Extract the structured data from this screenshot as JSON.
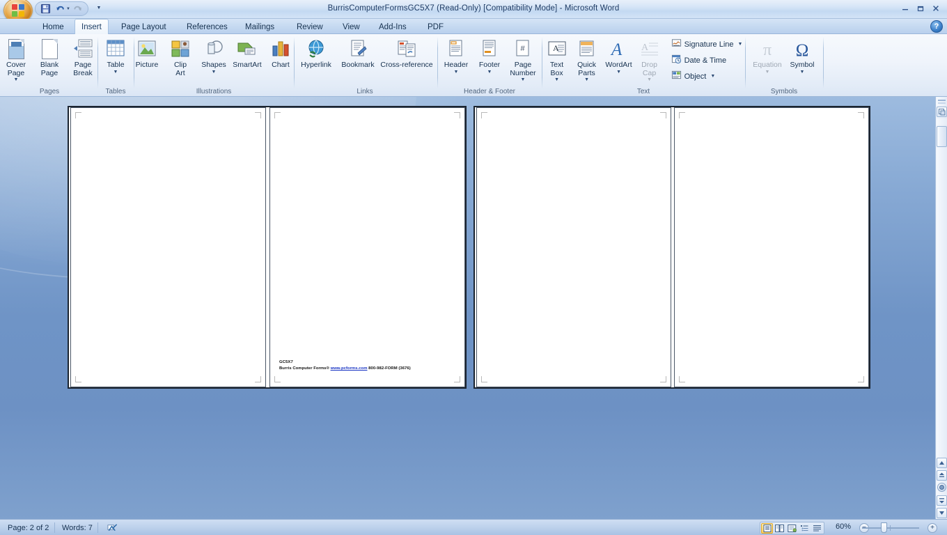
{
  "window": {
    "title": "BurrisComputerFormsGC5X7 (Read-Only) [Compatibility Mode] - Microsoft Word",
    "minimize_label": "Minimize",
    "restore_label": "Restore Down",
    "close_label": "Close",
    "help_label": "?"
  },
  "office_button": {
    "label": "Office Button"
  },
  "quick_access": {
    "items": [
      {
        "name": "save",
        "label": "Save",
        "icon": "save-icon"
      },
      {
        "name": "undo",
        "label": "Undo",
        "icon": "undo-icon",
        "dropdown": true
      },
      {
        "name": "redo",
        "label": "Redo",
        "icon": "redo-icon"
      }
    ],
    "customize_label": "Customize Quick Access Toolbar"
  },
  "ribbon": {
    "tabs": [
      {
        "label": "Home",
        "active": false
      },
      {
        "label": "Insert",
        "active": true
      },
      {
        "label": "Page Layout",
        "active": false
      },
      {
        "label": "References",
        "active": false
      },
      {
        "label": "Mailings",
        "active": false
      },
      {
        "label": "Review",
        "active": false
      },
      {
        "label": "View",
        "active": false
      },
      {
        "label": "Add-Ins",
        "active": false
      },
      {
        "label": "PDF",
        "active": false
      }
    ],
    "groups": [
      {
        "name": "pages",
        "label": "Pages",
        "items": [
          {
            "label": "Cover\nPage",
            "icon": "cover-page-icon",
            "dropdown": true,
            "disabled": false
          },
          {
            "label": "Blank\nPage",
            "icon": "blank-page-icon",
            "dropdown": false,
            "disabled": false
          },
          {
            "label": "Page\nBreak",
            "icon": "page-break-icon",
            "dropdown": false,
            "disabled": false
          }
        ]
      },
      {
        "name": "tables",
        "label": "Tables",
        "items": [
          {
            "label": "Table",
            "icon": "table-icon",
            "dropdown": true,
            "disabled": false
          }
        ]
      },
      {
        "name": "illustrations",
        "label": "Illustrations",
        "items": [
          {
            "label": "Picture",
            "icon": "picture-icon",
            "dropdown": false,
            "disabled": false
          },
          {
            "label": "Clip\nArt",
            "icon": "clip-art-icon",
            "dropdown": false,
            "disabled": false
          },
          {
            "label": "Shapes",
            "icon": "shapes-icon",
            "dropdown": true,
            "disabled": false
          },
          {
            "label": "SmartArt",
            "icon": "smartart-icon",
            "dropdown": false,
            "disabled": false
          },
          {
            "label": "Chart",
            "icon": "chart-icon",
            "dropdown": false,
            "disabled": false
          }
        ]
      },
      {
        "name": "links",
        "label": "Links",
        "items": [
          {
            "label": "Hyperlink",
            "icon": "hyperlink-icon",
            "dropdown": false,
            "disabled": false
          },
          {
            "label": "Bookmark",
            "icon": "bookmark-icon",
            "dropdown": false,
            "disabled": false
          },
          {
            "label": "Cross-reference",
            "icon": "cross-reference-icon",
            "dropdown": false,
            "disabled": false
          }
        ]
      },
      {
        "name": "header-footer",
        "label": "Header & Footer",
        "items": [
          {
            "label": "Header",
            "icon": "header-icon",
            "dropdown": true,
            "disabled": false
          },
          {
            "label": "Footer",
            "icon": "footer-icon",
            "dropdown": true,
            "disabled": false
          },
          {
            "label": "Page\nNumber",
            "icon": "page-number-icon",
            "dropdown": true,
            "disabled": false
          }
        ]
      },
      {
        "name": "text",
        "label": "Text",
        "items": [
          {
            "label": "Text\nBox",
            "icon": "text-box-icon",
            "dropdown": true,
            "disabled": false
          },
          {
            "label": "Quick\nParts",
            "icon": "quick-parts-icon",
            "dropdown": true,
            "disabled": false
          },
          {
            "label": "WordArt",
            "icon": "wordart-icon",
            "dropdown": true,
            "disabled": false
          },
          {
            "label": "Drop\nCap",
            "icon": "drop-cap-icon",
            "dropdown": true,
            "disabled": true
          }
        ],
        "small_items": [
          {
            "label": "Signature Line",
            "icon": "signature-line-icon",
            "dropdown": true,
            "disabled": false
          },
          {
            "label": "Date & Time",
            "icon": "date-time-icon",
            "dropdown": false,
            "disabled": false
          },
          {
            "label": "Object",
            "icon": "object-icon",
            "dropdown": true,
            "disabled": false
          }
        ]
      },
      {
        "name": "symbols",
        "label": "Symbols",
        "items": [
          {
            "label": "Equation",
            "icon": "equation-icon",
            "dropdown": true,
            "disabled": true
          },
          {
            "label": "Symbol",
            "icon": "symbol-icon",
            "dropdown": true,
            "disabled": false
          }
        ]
      }
    ]
  },
  "document": {
    "page2_text": {
      "line1": "GC5X7",
      "line2_prefix": "Burris Computer Forms® ",
      "link": "www.pcforms.com",
      "line2_suffix": " 800-982-FORM (3676)"
    },
    "spreads": [
      {
        "name": "spread-left",
        "pages": [
          "page-1-left",
          "page-2-right"
        ]
      },
      {
        "name": "spread-right",
        "pages": [
          "page-3-left",
          "page-4-right"
        ]
      }
    ]
  },
  "status_bar": {
    "page_label": "Page: 2 of 2",
    "words_label": "Words: 7",
    "proofing_label": "Proofing errors",
    "zoom_label": "60%",
    "zoom_out_label": "−",
    "zoom_in_label": "+",
    "view_buttons": [
      {
        "name": "print-layout",
        "label": "Print Layout",
        "active": true
      },
      {
        "name": "full-screen-reading",
        "label": "Full Screen Reading",
        "active": false
      },
      {
        "name": "web-layout",
        "label": "Web Layout",
        "active": false
      },
      {
        "name": "outline",
        "label": "Outline",
        "active": false
      },
      {
        "name": "draft",
        "label": "Draft",
        "active": false
      }
    ]
  },
  "scrollbar": {
    "split_label": "Split",
    "up_label": "Scroll Up",
    "down_label": "Scroll Down",
    "previous_page_label": "Previous Page",
    "browse_object_label": "Select Browse Object",
    "next_page_label": "Next Page"
  },
  "colors": {
    "accent": "#1b3c63",
    "desktop_blue": "#6f94c6",
    "link": "#1a35c4",
    "highlight_orange": "#ffcf5e"
  }
}
